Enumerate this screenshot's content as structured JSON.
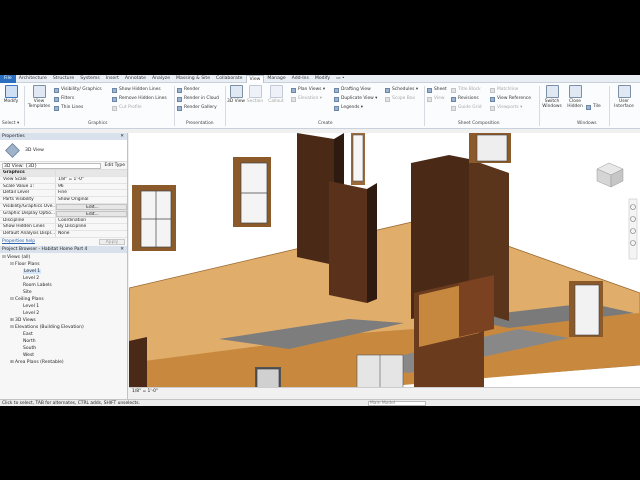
{
  "tabs": [
    "File",
    "Architecture",
    "Structure",
    "Systems",
    "Insert",
    "Annotate",
    "Analyze",
    "Massing & Site",
    "Collaborate",
    "View",
    "Manage",
    "Add-Ins",
    "Modify"
  ],
  "tab_extra": "▭ •",
  "active_tab": "View",
  "ribbon": {
    "modify": "Modify",
    "select": "Select ▾",
    "view_templates": "View Templates",
    "vg": "Visibility/ Graphics",
    "filters": "Filters",
    "thin_lines": "Thin Lines",
    "show_hidden": "Show  Hidden Lines",
    "remove_hidden": "Remove  Hidden Lines",
    "cut_profile": "Cut  Profile",
    "render": "Render",
    "render_cloud": "Render  in Cloud",
    "render_gallery": "Render  Gallery",
    "view3d": "3D View",
    "section": "Section",
    "callout": "Callout",
    "plan_views": "Plan  Views ▾",
    "elevation": "Elevation ▾",
    "drafting_view": "Drafting  View",
    "duplicate_view": "Duplicate  View ▾",
    "legends": "Legends ▾",
    "schedules": "Schedules ▾",
    "scope_box": "Scope  Box",
    "view": "View",
    "sheet": "Sheet",
    "revisions": "Revisions",
    "title_block": "Title  Block",
    "guide_grid": "Guide  Grid",
    "matchline": "Matchline",
    "view_reference": "View  Reference",
    "viewports": "Viewports ▾",
    "switch_windows": "Switch Windows",
    "close_hidden": "Close Hidden",
    "tile": "Tile",
    "user_interface": "User Interface",
    "panel_select": "Select",
    "panel_graphics": "Graphics",
    "panel_presentation": "Presentation",
    "panel_create": "Create",
    "panel_sheet": "Sheet  Composition",
    "panel_windows": "Windows"
  },
  "properties": {
    "title": "Properties",
    "close": "✕",
    "type": "3D View",
    "instance": "3D View: {3D}",
    "edit_type": "Edit Type",
    "rows": [
      {
        "k": "Graphics",
        "v": "",
        "grp": true
      },
      {
        "k": "View Scale",
        "v": "1/8\" = 1'-0\""
      },
      {
        "k": "Scale Value  1:",
        "v": "96"
      },
      {
        "k": "Detail Level",
        "v": "Fine"
      },
      {
        "k": "Parts Visibility",
        "v": "Show Original"
      },
      {
        "k": "Visibility/Graphics Ove...",
        "v": "Edit...",
        "btn": true
      },
      {
        "k": "Graphic Display Optio...",
        "v": "Edit...",
        "btn": true
      },
      {
        "k": "Discipline",
        "v": "Coordination"
      },
      {
        "k": "Show Hidden Lines",
        "v": "By Discipline"
      },
      {
        "k": "Default Analysis Displ...",
        "v": "None"
      }
    ],
    "help": "Properties help",
    "apply": "Apply"
  },
  "browser": {
    "title": "Project Browser - Habitat Home Part 4",
    "close": "✕",
    "items": [
      {
        "t": "⊟",
        "l": "Views (all)",
        "d": 0
      },
      {
        "t": "⊟",
        "l": "Floor Plans",
        "d": 1
      },
      {
        "t": "",
        "l": "Level 1",
        "d": 2,
        "sel": true
      },
      {
        "t": "",
        "l": "Level 2",
        "d": 2
      },
      {
        "t": "",
        "l": "Room Labels",
        "d": 2
      },
      {
        "t": "",
        "l": "Site",
        "d": 2
      },
      {
        "t": "⊟",
        "l": "Ceiling Plans",
        "d": 1
      },
      {
        "t": "",
        "l": "Level 1",
        "d": 2
      },
      {
        "t": "",
        "l": "Level 2",
        "d": 2
      },
      {
        "t": "⊞",
        "l": "3D Views",
        "d": 1
      },
      {
        "t": "⊟",
        "l": "Elevations (Building Elevation)",
        "d": 1
      },
      {
        "t": "",
        "l": "East",
        "d": 2
      },
      {
        "t": "",
        "l": "North",
        "d": 2
      },
      {
        "t": "",
        "l": "South",
        "d": 2
      },
      {
        "t": "",
        "l": "West",
        "d": 2
      },
      {
        "t": "⊞",
        "l": "Area Plans (Rentable)",
        "d": 1
      }
    ]
  },
  "viewbar": "1/8\" = 1'-0\"",
  "status": "Click to select, TAB for alternates, CTRL adds, SHIFT unselects.",
  "main_model": "Main Model",
  "colors": {
    "wall": "#4a2a17",
    "floor": "#e0ad6a",
    "slab": "#8b8b8b",
    "frame": "#b98656"
  }
}
